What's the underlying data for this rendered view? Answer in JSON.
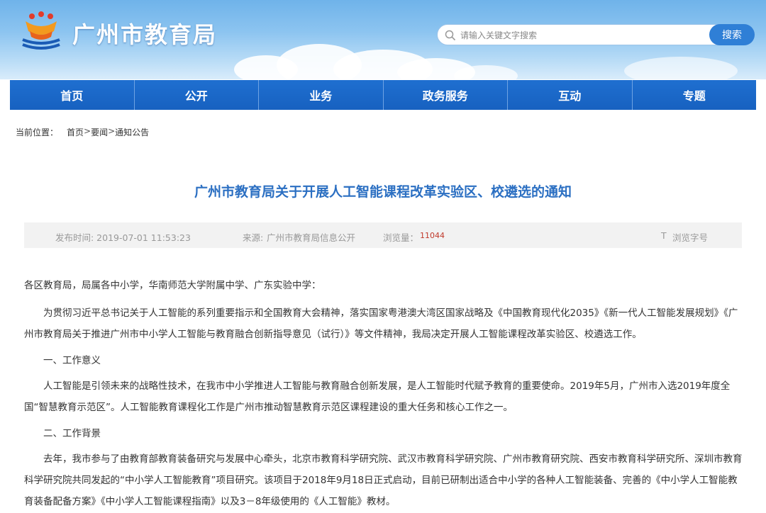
{
  "header": {
    "site_title": "广州市教育局",
    "logo_icon": "guangzhou-education-logo",
    "search": {
      "placeholder": "请输入关键文字搜索",
      "button_label": "搜索",
      "icon": "search-icon"
    },
    "colors": {
      "accent": "#2f7fd6",
      "nav": "#1a66c8",
      "title": "#2b6fc2"
    }
  },
  "nav": {
    "items": [
      {
        "label": "首页"
      },
      {
        "label": "公开"
      },
      {
        "label": "业务"
      },
      {
        "label": "政务服务"
      },
      {
        "label": "互动"
      },
      {
        "label": "专题"
      }
    ]
  },
  "breadcrumb": {
    "prefix": "当前位置：",
    "items": [
      "首页",
      "要闻",
      "通知公告"
    ],
    "separator": ">"
  },
  "article": {
    "title": "广州市教育局关于开展人工智能课程改革实验区、校遴选的通知",
    "meta": {
      "published": "发布时间: 2019-07-01 11:53:23",
      "source_label": "来源:",
      "source": "广州市教育局信息公开",
      "views_label": "浏览量：",
      "views": "11044",
      "font_toggle_icon": "T",
      "font_toggle_label": "浏览字号"
    },
    "salutation": "各区教育局，局属各中小学，华南师范大学附属中学、广东实验中学：",
    "paragraphs": [
      "为贯彻习近平总书记关于人工智能的系列重要指示和全国教育大会精神，落实国家粤港澳大湾区国家战略及《中国教育现代化2035》《新一代人工智能发展规划》《广州市教育局关于推进广州市中小学人工智能与教育融合创新指导意见（试行）》等文件精神，我局决定开展人工智能课程改革实验区、校遴选工作。",
      "一、工作意义",
      "人工智能是引领未来的战略性技术，在我市中小学推进人工智能与教育融合创新发展，是人工智能时代赋予教育的重要使命。2019年5月，广州市入选2019年度全国“智慧教育示范区”。人工智能教育课程化工作是广州市推动智慧教育示范区课程建设的重大任务和核心工作之一。",
      "二、工作背景",
      "去年，我市参与了由教育部教育装备研究与发展中心牵头，北京市教育科学研究院、武汉市教育科学研究院、广州市教育研究院、西安市教育科学研究所、深圳市教育科学研究院共同发起的“中小学人工智能教育”项目研究。该项目于2018年9月18日正式启动，目前已研制出适合中小学的各种人工智能装备、完善的《中小学人工智能教育装备配备方案》《中小学人工智能课程指南》以及3－8年级使用的《人工智能》教材。"
    ]
  }
}
